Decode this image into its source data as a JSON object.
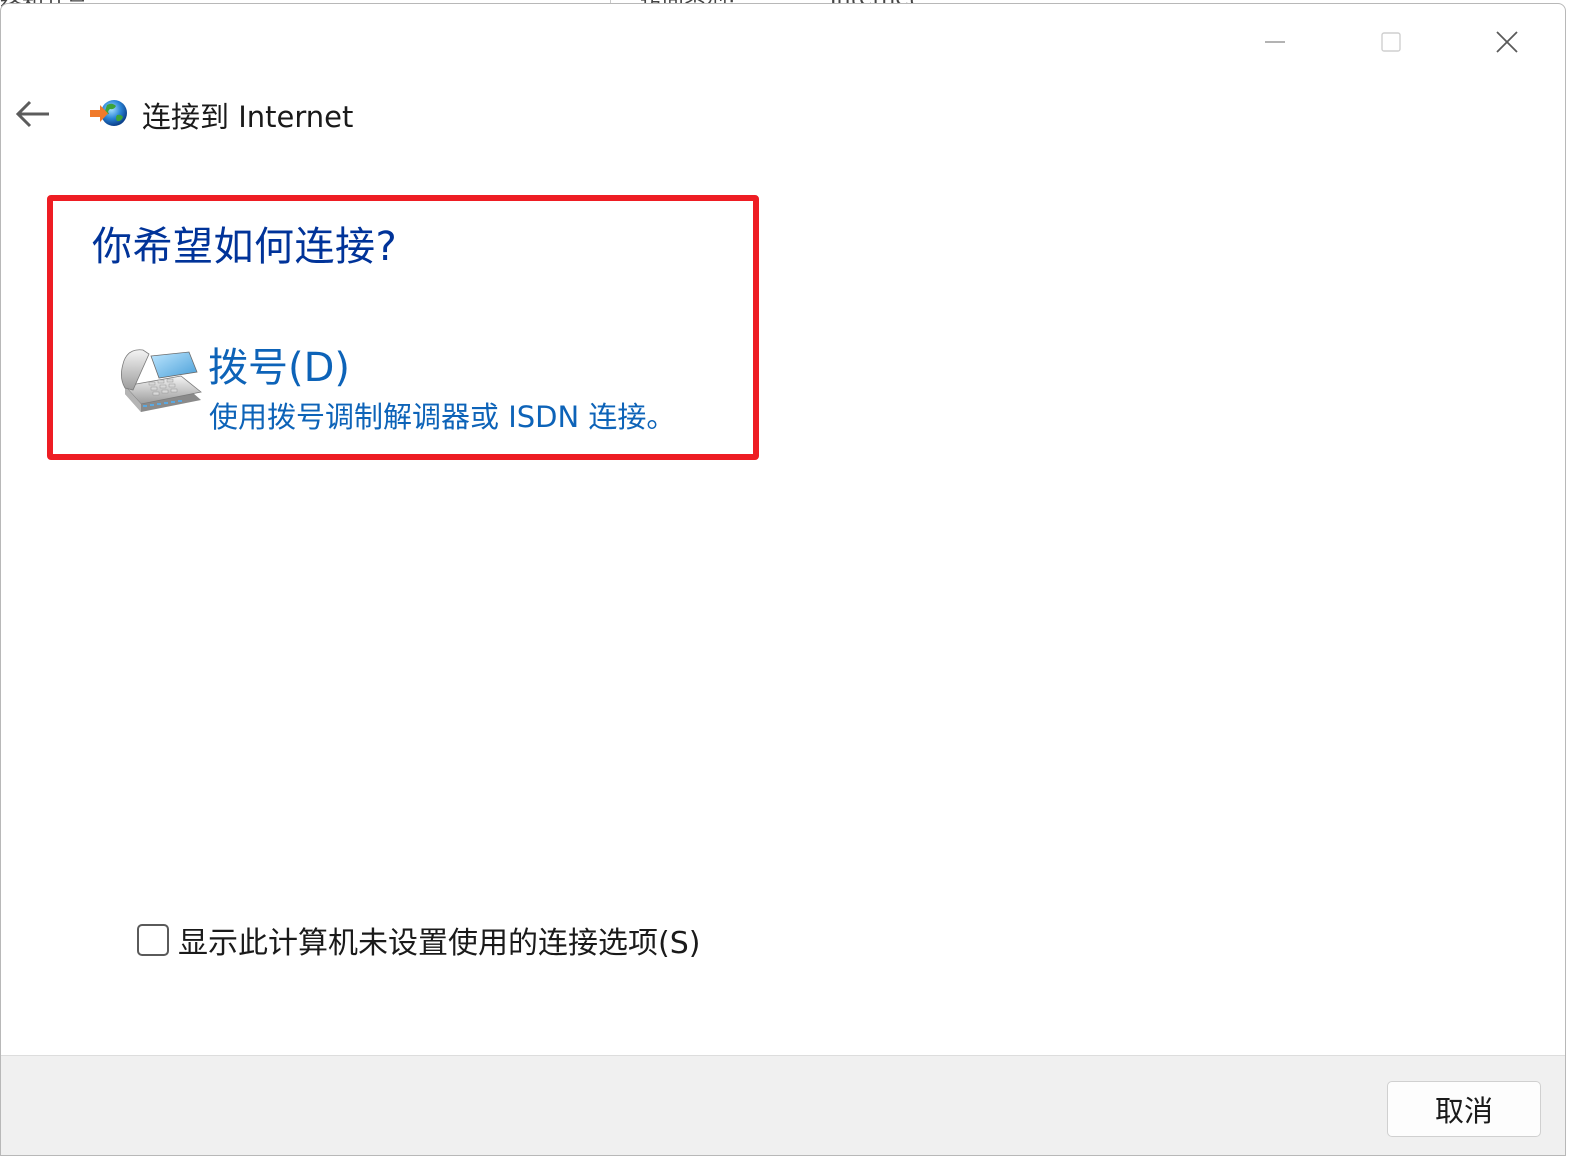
{
  "background_window": {
    "fragment_left": "络和共享",
    "fragment_mid": "访问类型:",
    "fragment_right": "Internet"
  },
  "titlebar": {
    "minimize_icon": "minimize-icon",
    "maximize_icon": "maximize-icon",
    "close_icon": "close-icon"
  },
  "header": {
    "back_icon": "back-arrow-icon",
    "app_icon": "connect-to-internet-icon",
    "title": "连接到 Internet"
  },
  "main": {
    "question": "你希望如何连接?",
    "options": [
      {
        "icon": "telephone-modem-icon",
        "title": "拨号(D)",
        "description": "使用拨号调制解调器或 ISDN 连接。"
      }
    ],
    "highlight_color": "#ee1d23",
    "link_color": "#0d63b8",
    "heading_color": "#003399"
  },
  "checkbox": {
    "checked": false,
    "label": "显示此计算机未设置使用的连接选项(S)"
  },
  "footer": {
    "cancel_label": "取消"
  }
}
